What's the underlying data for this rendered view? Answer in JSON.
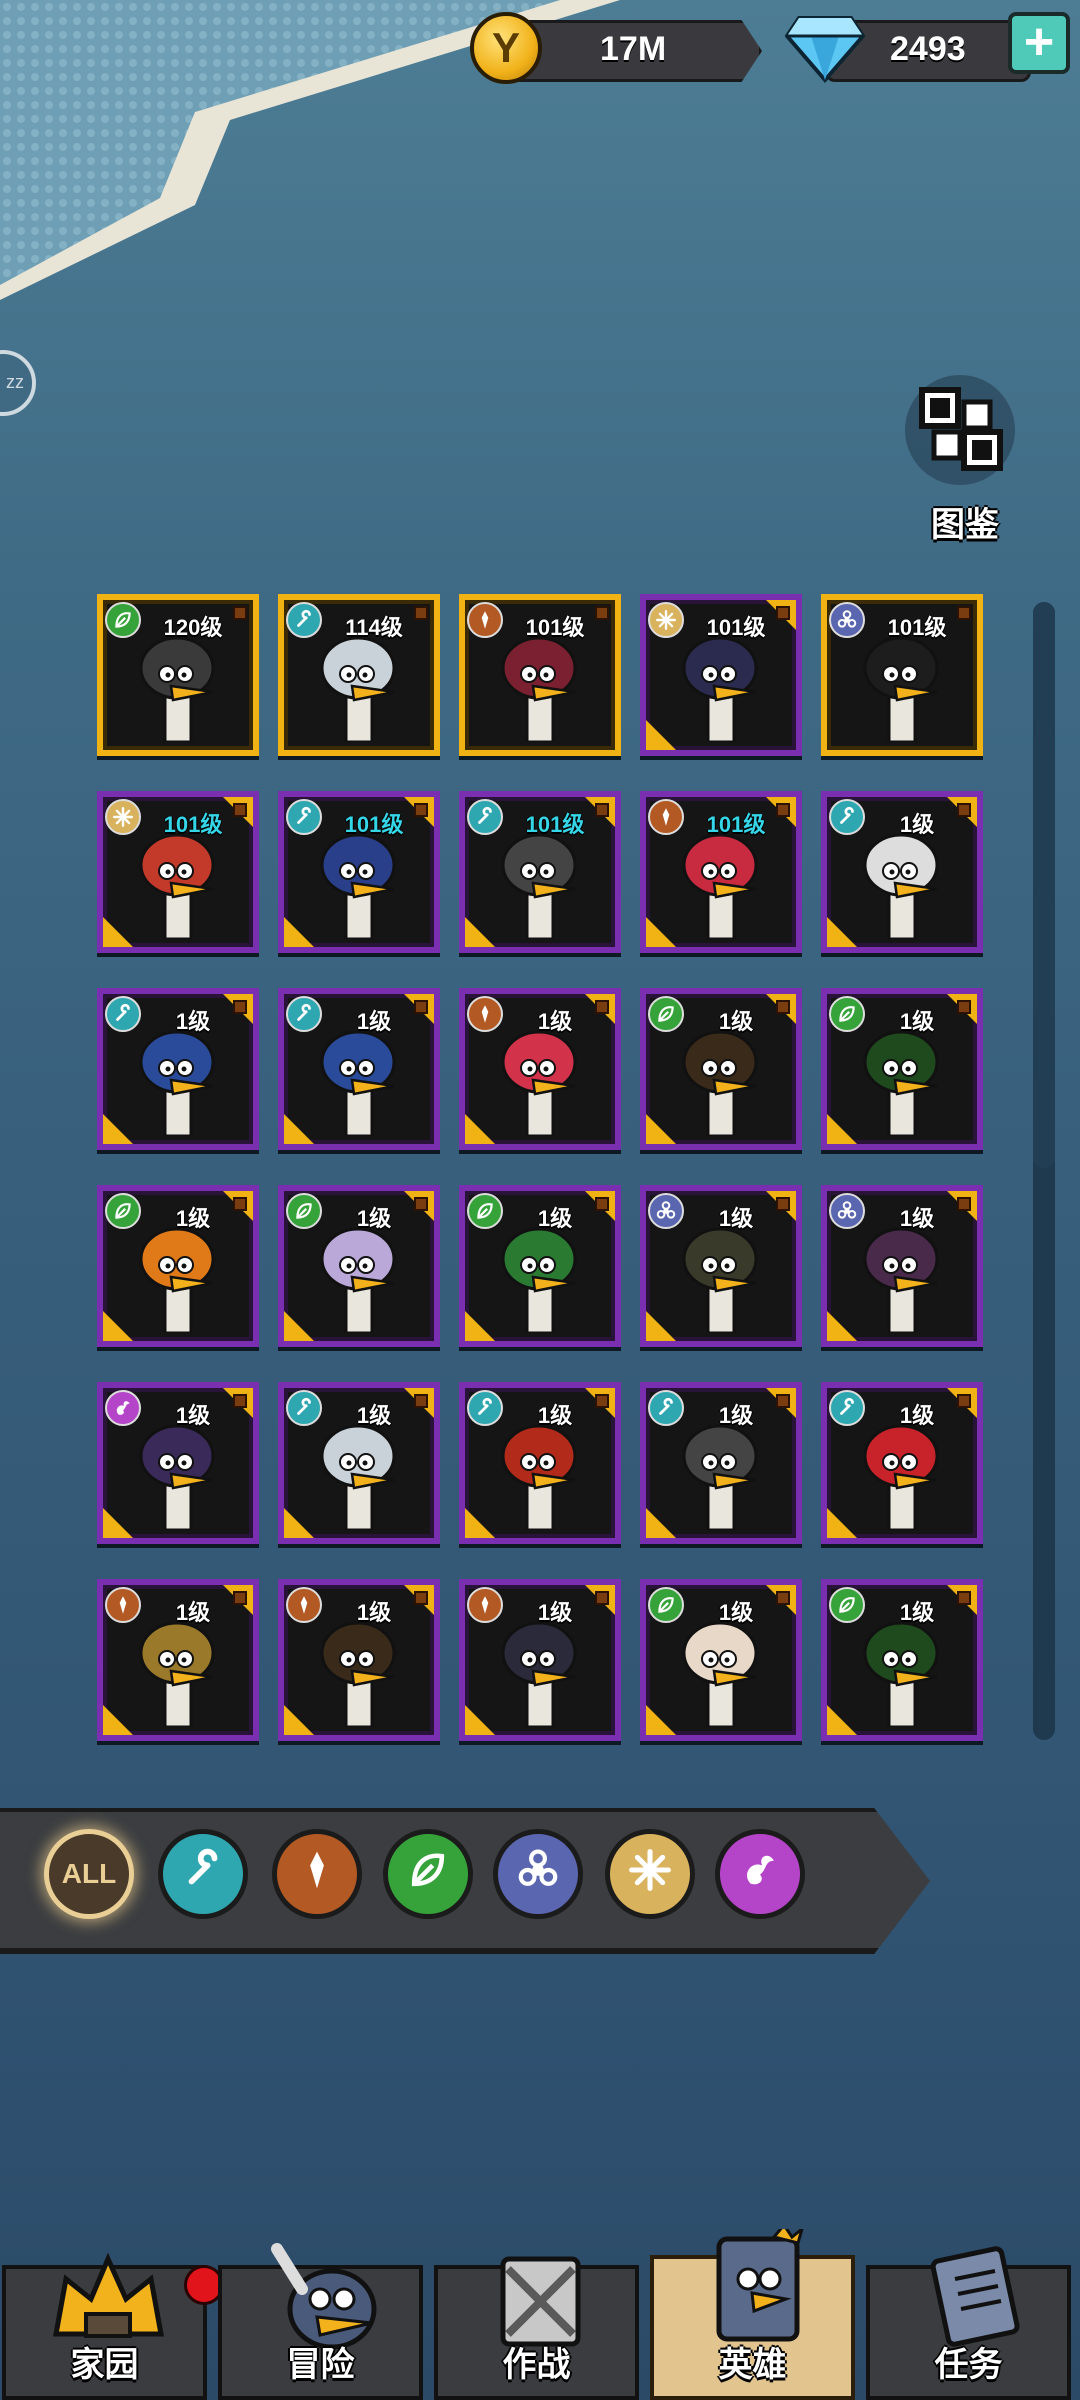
{
  "currency": {
    "coins": "17M",
    "gems": "2493",
    "coin_symbol": "Y",
    "plus_label": "+"
  },
  "side_tab": {
    "label": "zz"
  },
  "codex": {
    "label": "图鉴"
  },
  "class_colors": {
    "tech": "#2fa7b0",
    "warrior": "#b35a24",
    "nature": "#35a33a",
    "toxic": "#5a66b0",
    "light": "#d8b25c",
    "mystic": "#b545c8"
  },
  "heroes": [
    {
      "level": "120级",
      "class": "nature",
      "rarity": "gold",
      "highlight": false
    },
    {
      "level": "114级",
      "class": "tech",
      "rarity": "gold",
      "highlight": false
    },
    {
      "level": "101级",
      "class": "warrior",
      "rarity": "gold",
      "highlight": false
    },
    {
      "level": "101级",
      "class": "light",
      "rarity": "purple",
      "highlight": false
    },
    {
      "level": "101级",
      "class": "toxic",
      "rarity": "gold",
      "highlight": false
    },
    {
      "level": "101级",
      "class": "light",
      "rarity": "purple",
      "highlight": true
    },
    {
      "level": "101级",
      "class": "tech",
      "rarity": "purple",
      "highlight": true
    },
    {
      "level": "101级",
      "class": "tech",
      "rarity": "purple",
      "highlight": true
    },
    {
      "level": "101级",
      "class": "warrior",
      "rarity": "purple",
      "highlight": true
    },
    {
      "level": "1级",
      "class": "tech",
      "rarity": "purple",
      "highlight": false
    },
    {
      "level": "1级",
      "class": "tech",
      "rarity": "purple",
      "highlight": false
    },
    {
      "level": "1级",
      "class": "tech",
      "rarity": "purple",
      "highlight": false
    },
    {
      "level": "1级",
      "class": "warrior",
      "rarity": "purple",
      "highlight": false
    },
    {
      "level": "1级",
      "class": "nature",
      "rarity": "purple",
      "highlight": false
    },
    {
      "level": "1级",
      "class": "nature",
      "rarity": "purple",
      "highlight": false
    },
    {
      "level": "1级",
      "class": "nature",
      "rarity": "purple",
      "highlight": false
    },
    {
      "level": "1级",
      "class": "nature",
      "rarity": "purple",
      "highlight": false
    },
    {
      "level": "1级",
      "class": "nature",
      "rarity": "purple",
      "highlight": false
    },
    {
      "level": "1级",
      "class": "toxic",
      "rarity": "purple",
      "highlight": false
    },
    {
      "level": "1级",
      "class": "toxic",
      "rarity": "purple",
      "highlight": false
    },
    {
      "level": "1级",
      "class": "mystic",
      "rarity": "purple",
      "highlight": false
    },
    {
      "level": "1级",
      "class": "tech",
      "rarity": "purple",
      "highlight": false
    },
    {
      "level": "1级",
      "class": "tech",
      "rarity": "purple",
      "highlight": false
    },
    {
      "level": "1级",
      "class": "tech",
      "rarity": "purple",
      "highlight": false
    },
    {
      "level": "1级",
      "class": "tech",
      "rarity": "purple",
      "highlight": false
    },
    {
      "level": "1级",
      "class": "warrior",
      "rarity": "purple",
      "highlight": false
    },
    {
      "level": "1级",
      "class": "warrior",
      "rarity": "purple",
      "highlight": false
    },
    {
      "level": "1级",
      "class": "warrior",
      "rarity": "purple",
      "highlight": false
    },
    {
      "level": "1级",
      "class": "nature",
      "rarity": "purple",
      "highlight": false
    },
    {
      "level": "1级",
      "class": "nature",
      "rarity": "purple",
      "highlight": false
    }
  ],
  "filters": [
    {
      "id": "all",
      "label": "ALL",
      "selected": true
    },
    {
      "id": "tech",
      "label": "",
      "selected": false
    },
    {
      "id": "warrior",
      "label": "",
      "selected": false
    },
    {
      "id": "nature",
      "label": "",
      "selected": false
    },
    {
      "id": "toxic",
      "label": "",
      "selected": false
    },
    {
      "id": "light",
      "label": "",
      "selected": false
    },
    {
      "id": "mystic",
      "label": "",
      "selected": false
    }
  ],
  "nav": [
    {
      "label": "家园",
      "icon": "home-icon",
      "active": false,
      "notify": true
    },
    {
      "label": "冒险",
      "icon": "adventure-icon",
      "active": false,
      "notify": false
    },
    {
      "label": "作战",
      "icon": "battle-icon",
      "active": false,
      "notify": false
    },
    {
      "label": "英雄",
      "icon": "heroes-icon",
      "active": true,
      "notify": false
    },
    {
      "label": "任务",
      "icon": "quests-icon",
      "active": false,
      "notify": false
    }
  ]
}
